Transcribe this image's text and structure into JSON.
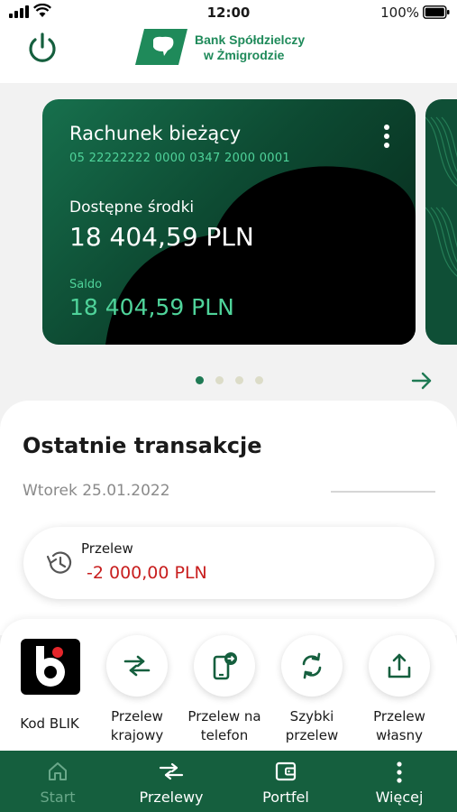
{
  "status_bar": {
    "time": "12:00",
    "battery": "100%"
  },
  "header": {
    "bank_name_line1": "Bank Spółdzielczy",
    "bank_name_line2": "w Żmigrodzie"
  },
  "account_card": {
    "title": "Rachunek bieżący",
    "iban": "05 22222222 0000 0347 2000 0001",
    "available_label": "Dostępne środki",
    "available_amount": "18 404,59 PLN",
    "balance_label": "Saldo",
    "balance_amount": "18 404,59 PLN"
  },
  "carousel": {
    "pages": 4,
    "active_index": 0
  },
  "transactions": {
    "heading": "Ostatnie transakcje",
    "date": "Wtorek 25.01.2022",
    "items": [
      {
        "type": "Przelew",
        "amount": "-2 000,00 PLN"
      }
    ]
  },
  "quick_actions": {
    "blik_label": "Kod BLIK",
    "items": [
      {
        "line1": "Przelew",
        "line2": "krajowy",
        "icon": "arrows-exchange-icon"
      },
      {
        "line1": "Przelew na",
        "line2": "telefon",
        "icon": "phone-transfer-icon"
      },
      {
        "line1": "Szybki",
        "line2": "przelew",
        "icon": "refresh-icon"
      },
      {
        "line1": "Przelew",
        "line2": "własny",
        "icon": "upload-icon"
      }
    ]
  },
  "bottom_nav": [
    {
      "label": "Start",
      "icon": "home-icon",
      "active": true
    },
    {
      "label": "Przelewy",
      "icon": "transfers-icon",
      "active": false
    },
    {
      "label": "Portfel",
      "icon": "wallet-icon",
      "active": false
    },
    {
      "label": "Więcej",
      "icon": "more-icon",
      "active": false
    }
  ],
  "colors": {
    "brand": "#155f3e",
    "accent": "#1f8a5a",
    "negative": "#c81e1e"
  }
}
